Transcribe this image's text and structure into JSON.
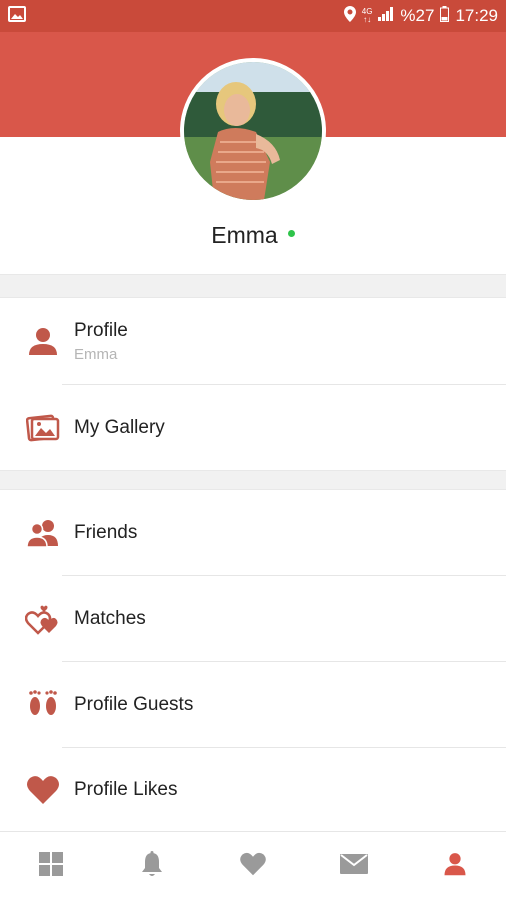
{
  "status_bar": {
    "network_top": "4G",
    "network_bottom": "↑↓",
    "battery": "%27",
    "time": "17:29"
  },
  "profile": {
    "name": "Emma",
    "online_color": "#2ec44a"
  },
  "menu": {
    "profile": {
      "label": "Profile",
      "sub": "Emma",
      "icon": "person-icon"
    },
    "gallery": {
      "label": "My Gallery",
      "icon": "gallery-icon"
    },
    "friends": {
      "label": "Friends",
      "icon": "friends-icon"
    },
    "matches": {
      "label": "Matches",
      "icon": "hearts-icon"
    },
    "guests": {
      "label": "Profile Guests",
      "icon": "footprints-icon"
    },
    "likes": {
      "label": "Profile Likes",
      "icon": "heart-icon"
    }
  },
  "bottom_nav": [
    {
      "icon": "grid-icon",
      "active": false
    },
    {
      "icon": "bell-icon",
      "active": false
    },
    {
      "icon": "heart-icon",
      "active": false
    },
    {
      "icon": "mail-icon",
      "active": false
    },
    {
      "icon": "person-icon",
      "active": true
    }
  ],
  "colors": {
    "accent": "#d9574a",
    "status_bar": "#c94a3a",
    "icon": "#c0584a",
    "inactive_nav": "#9a9a9a"
  }
}
